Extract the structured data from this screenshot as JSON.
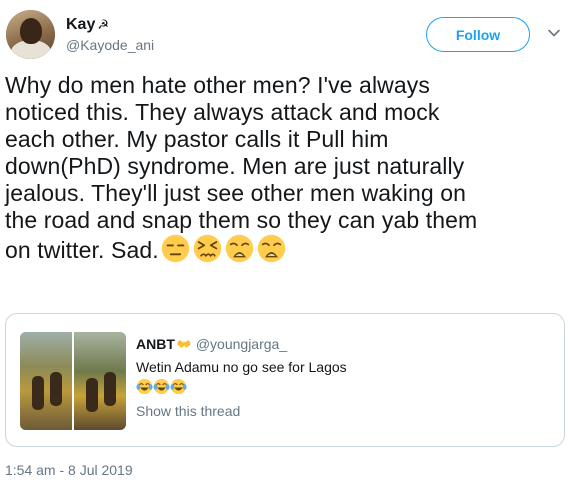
{
  "header": {
    "display_name": "Kay",
    "handle": "@Kayode_ani",
    "follow_label": "Follow"
  },
  "tweet": {
    "lines": [
      "Why do men hate other men? I've always",
      "noticed this. They always attack and mock",
      "each other. My pastor calls it Pull him",
      "down(PhD) syndrome. Men are just naturally",
      "jealous. They'll just see other men waking on",
      "the road and snap them so they can yab them",
      "on twitter. Sad."
    ],
    "emojis": [
      "expressionless-face",
      "persevering-face",
      "weary-face",
      "weary-face"
    ],
    "timestamp": "1:54 am - 8 Jul 2019"
  },
  "quoted_tweet": {
    "display_name": "ANBT",
    "handle": "@youngjarga_",
    "text": "Wetin Adamu no go see for Lagos",
    "emojis": [
      "tears-of-joy-face",
      "tears-of-joy-face",
      "tears-of-joy-face"
    ],
    "show_thread": "Show this thread"
  },
  "colors": {
    "accent": "#1da1f2",
    "text": "#14171a",
    "secondary": "#657786",
    "border": "#ccd6dd",
    "emoji_yellow": "#ffcc4d"
  }
}
